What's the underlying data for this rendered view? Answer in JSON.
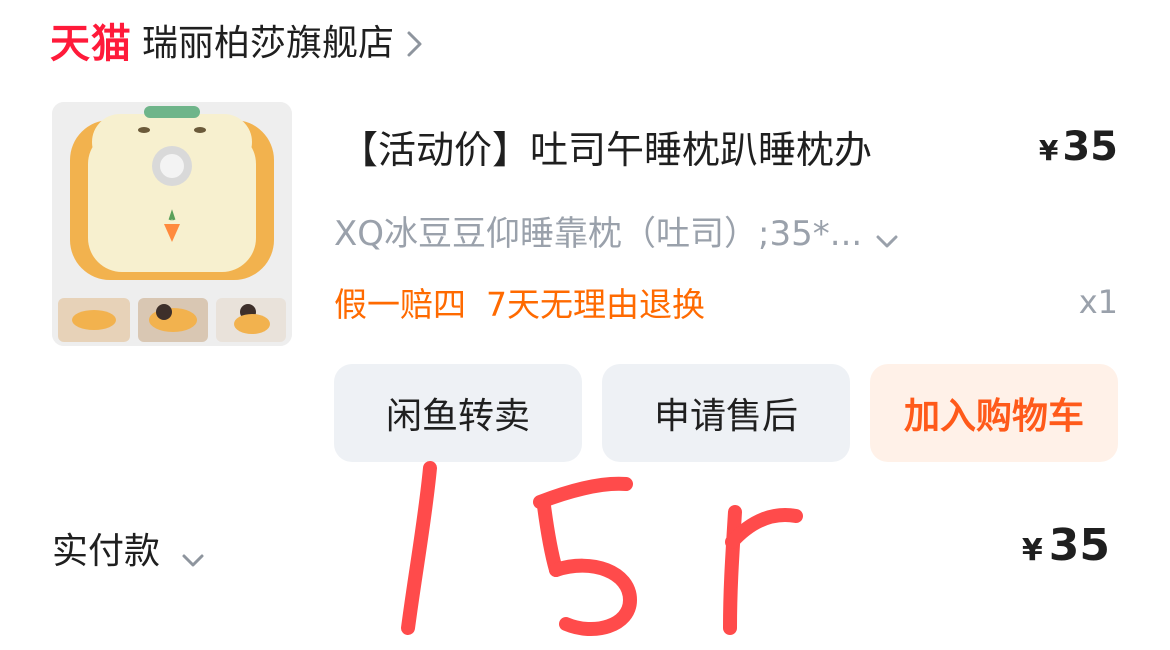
{
  "header": {
    "brand_logo": "天猫",
    "store_name": "瑞丽柏莎旗舰店"
  },
  "product": {
    "title": "【活动价】吐司午睡枕趴睡枕办",
    "price_symbol": "¥",
    "price": "35",
    "spec": "XQ冰豆豆仰睡靠枕（吐司）;35*...",
    "badge_1": "假一赔四",
    "badge_2": "7天无理由退换",
    "quantity": "x1"
  },
  "actions": {
    "xianyu_label": "闲鱼转卖",
    "aftersale_label": "申请售后",
    "cart_label": "加入购物车"
  },
  "payment": {
    "label": "实付款",
    "price_symbol": "¥",
    "amount": "35"
  },
  "annotation": {
    "handwriting": "15r"
  },
  "colors": {
    "brand_red": "#ff1a3a",
    "badge_orange": "#ff6a00",
    "cart_button_text": "#ff5a1a",
    "cart_button_bg": "#fff1e8",
    "neutral_button_bg": "#eef1f5",
    "muted_text": "#9aa1ab",
    "handwriting_red": "#ff4b4b"
  },
  "icons": {
    "store_chevron": "chevron-right-icon",
    "spec_chevron": "chevron-down-icon",
    "paid_chevron": "chevron-down-icon"
  }
}
